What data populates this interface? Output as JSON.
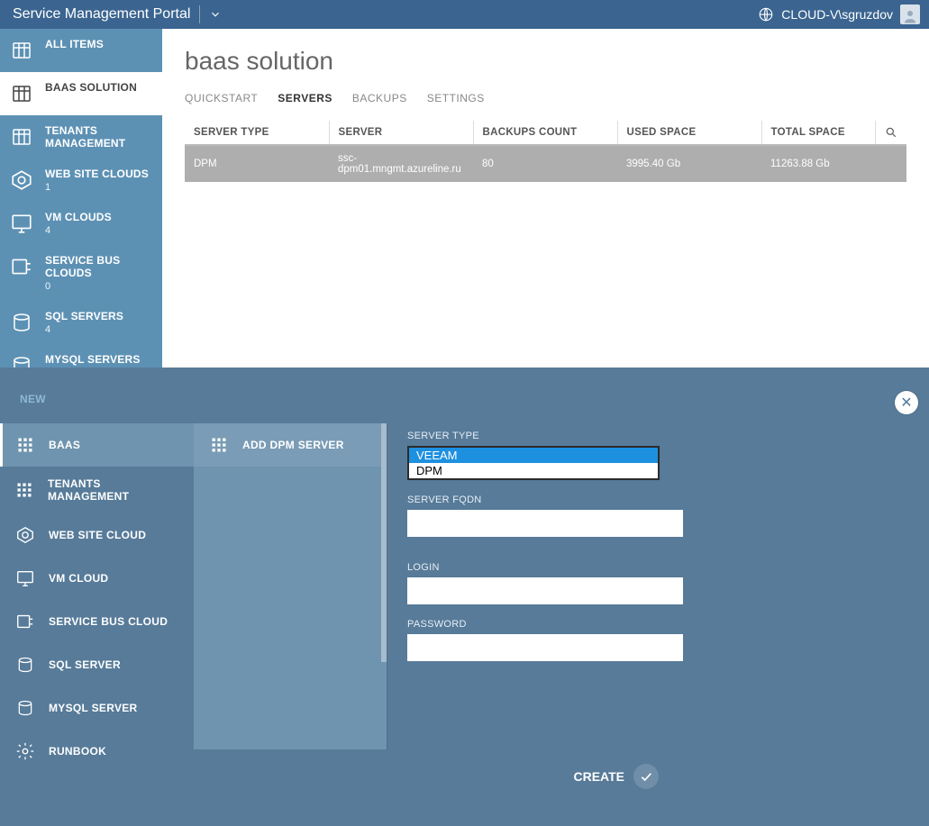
{
  "header": {
    "title": "Service Management Portal",
    "user": "CLOUD-V\\sgruzdov"
  },
  "sidebar": {
    "items": [
      {
        "label": "ALL ITEMS",
        "count": ""
      },
      {
        "label": "BAAS SOLUTION",
        "count": ""
      },
      {
        "label": "TENANTS MANAGEMENT",
        "count": ""
      },
      {
        "label": "WEB SITE CLOUDS",
        "count": "1"
      },
      {
        "label": "VM CLOUDS",
        "count": "4"
      },
      {
        "label": "SERVICE BUS CLOUDS",
        "count": "0"
      },
      {
        "label": "SQL SERVERS",
        "count": "4"
      },
      {
        "label": "MYSQL SERVERS",
        "count": ""
      }
    ]
  },
  "main": {
    "title": "baas solution",
    "tabs": [
      {
        "label": "QUICKSTART"
      },
      {
        "label": "SERVERS"
      },
      {
        "label": "BACKUPS"
      },
      {
        "label": "SETTINGS"
      }
    ],
    "columns": {
      "c0": "SERVER TYPE",
      "c1": "SERVER",
      "c2": "BACKUPS COUNT",
      "c3": "USED SPACE",
      "c4": "TOTAL SPACE"
    },
    "rows": [
      {
        "type": "DPM",
        "server": "ssc-dpm01.mngmt.azureline.ru",
        "backups": "80",
        "used": "3995.40 Gb",
        "total": "11263.88 Gb"
      }
    ]
  },
  "overlay": {
    "title": "NEW",
    "col1": [
      {
        "label": "BAAS"
      },
      {
        "label": "TENANTS MANAGEMENT"
      },
      {
        "label": "WEB SITE CLOUD"
      },
      {
        "label": "VM CLOUD"
      },
      {
        "label": "SERVICE BUS CLOUD"
      },
      {
        "label": "SQL SERVER"
      },
      {
        "label": "MYSQL SERVER"
      },
      {
        "label": "RUNBOOK"
      }
    ],
    "col2": [
      {
        "label": "ADD DPM SERVER"
      }
    ],
    "form": {
      "server_type_label": "SERVER TYPE",
      "server_type_options": {
        "o0": "VEEAM",
        "o1": "DPM"
      },
      "fqdn_label": "SERVER FQDN",
      "fqdn_value": "",
      "login_label": "LOGIN",
      "login_value": "",
      "password_label": "PASSWORD",
      "password_value": ""
    },
    "footer": {
      "create": "CREATE"
    }
  }
}
